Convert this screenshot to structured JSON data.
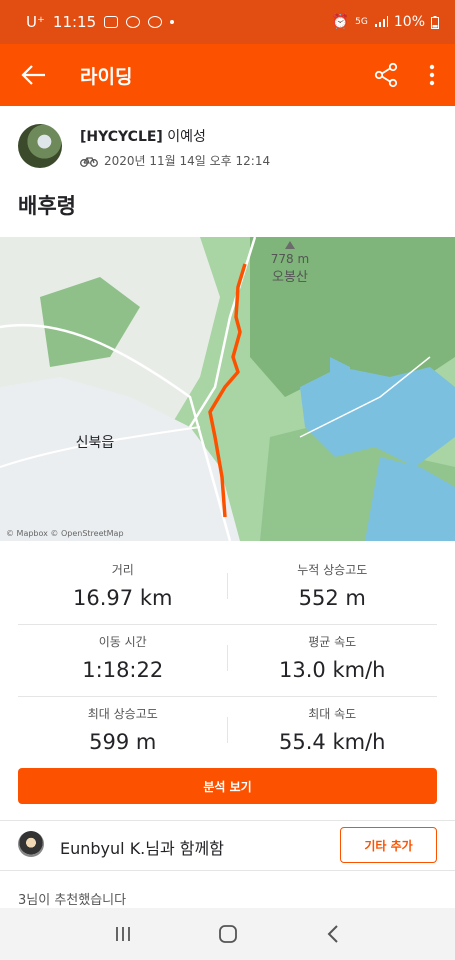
{
  "status_bar": {
    "carrier": "U⁺",
    "time": "11:15",
    "network": "5G",
    "battery": "10%"
  },
  "app_bar": {
    "title": "라이딩",
    "back_icon": "arrow-left-icon",
    "share_icon": "share-icon",
    "more_icon": "more-vertical-icon"
  },
  "activity": {
    "athlete_tag": "[HYCYCLE]",
    "athlete_name": " 이예성",
    "date": "2020년 11월 14일 오후 12:14",
    "sport_icon": "bike-icon",
    "title": "배후령"
  },
  "map": {
    "peak_label": "778 m",
    "peak_name": "오봉산",
    "town_label": "신북읍",
    "attribution": "© Mapbox © OpenStreetMap",
    "route_color": "#fc5200"
  },
  "stats": {
    "distance_label": "거리",
    "distance_value": "16.97 km",
    "elevation_gain_label": "누적 상승고도",
    "elevation_gain_value": "552 m",
    "moving_time_label": "이동 시간",
    "moving_time_value": "1:18:22",
    "avg_speed_label": "평균 속도",
    "avg_speed_value": "13.0 km/h",
    "max_elev_label": "최대 상승고도",
    "max_elev_value": "599 m",
    "max_speed_label": "최대 속도",
    "max_speed_value": "55.4 km/h"
  },
  "analysis_button": "분석 보기",
  "group": {
    "text": "Eunbyul K.님과 함께함",
    "other_button": "기타 추가"
  },
  "kudos_text": "3님이 추천했습니다",
  "colors": {
    "brand": "#fc5200",
    "status_bar": "#e24d12"
  }
}
